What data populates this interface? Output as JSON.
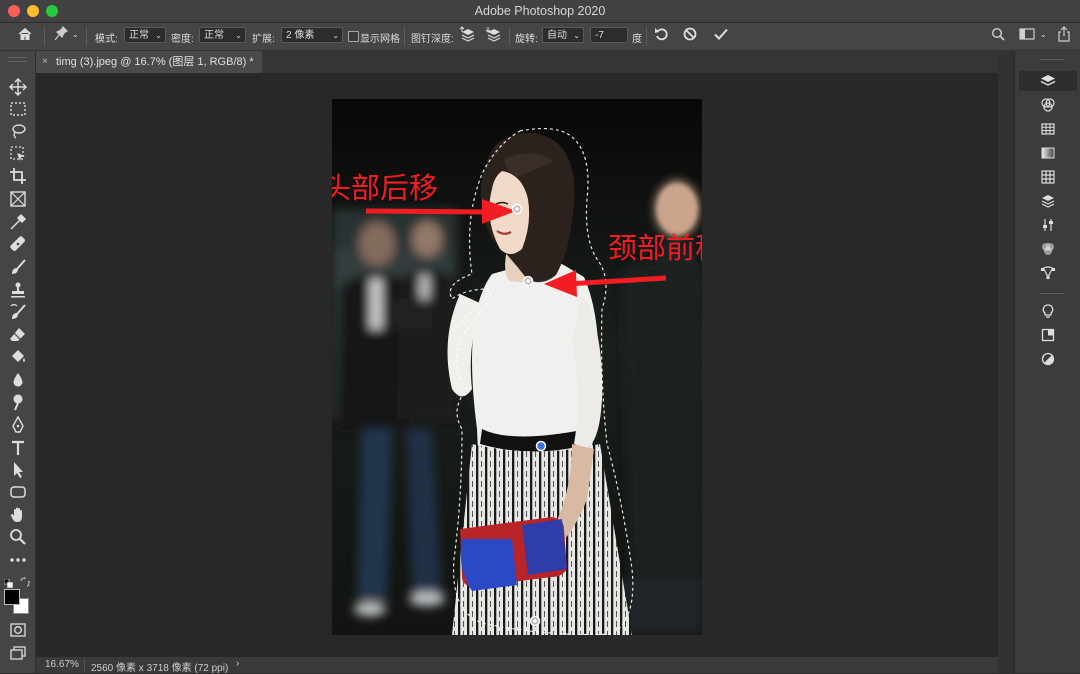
{
  "window": {
    "title": "Adobe Photoshop 2020"
  },
  "options_bar": {
    "mode_label": "模式:",
    "mode_value": "正常",
    "density_label": "密度:",
    "density_value": "正常",
    "expansion_label": "扩展:",
    "expansion_value": "2 像素",
    "show_mesh_label": "显示网格",
    "pin_depth_label": "图钉深度:",
    "rotate_label": "旋转:",
    "rotate_mode": "自动",
    "rotate_value": "-7",
    "rotate_unit": "度"
  },
  "document_tab": {
    "title": "timg (3).jpeg @ 16.7% (图层 1, RGB/8) *",
    "close": "×"
  },
  "annotations": {
    "head": "头部后移",
    "neck": "颈部前移",
    "color": "#f21d23"
  },
  "status_bar": {
    "zoom": "16.67%",
    "doc_info": "2560 像素 x 3718 像素 (72 ppi)",
    "arrow": "›"
  },
  "tools": [
    "move-tool",
    "marquee-tool",
    "lasso-tool",
    "object-select-tool",
    "crop-tool",
    "frame-tool",
    "eyedropper-tool",
    "healing-brush-tool",
    "brush-tool",
    "clone-stamp-tool",
    "history-brush-tool",
    "eraser-tool",
    "paint-bucket-tool",
    "blur-tool",
    "dodge-tool",
    "pen-tool",
    "type-tool",
    "path-select-tool",
    "shape-tool",
    "hand-tool",
    "zoom-tool",
    "more-tools"
  ],
  "colors": {
    "foreground": "#000000",
    "background": "#ffffff",
    "ui_dark": "#282828"
  }
}
